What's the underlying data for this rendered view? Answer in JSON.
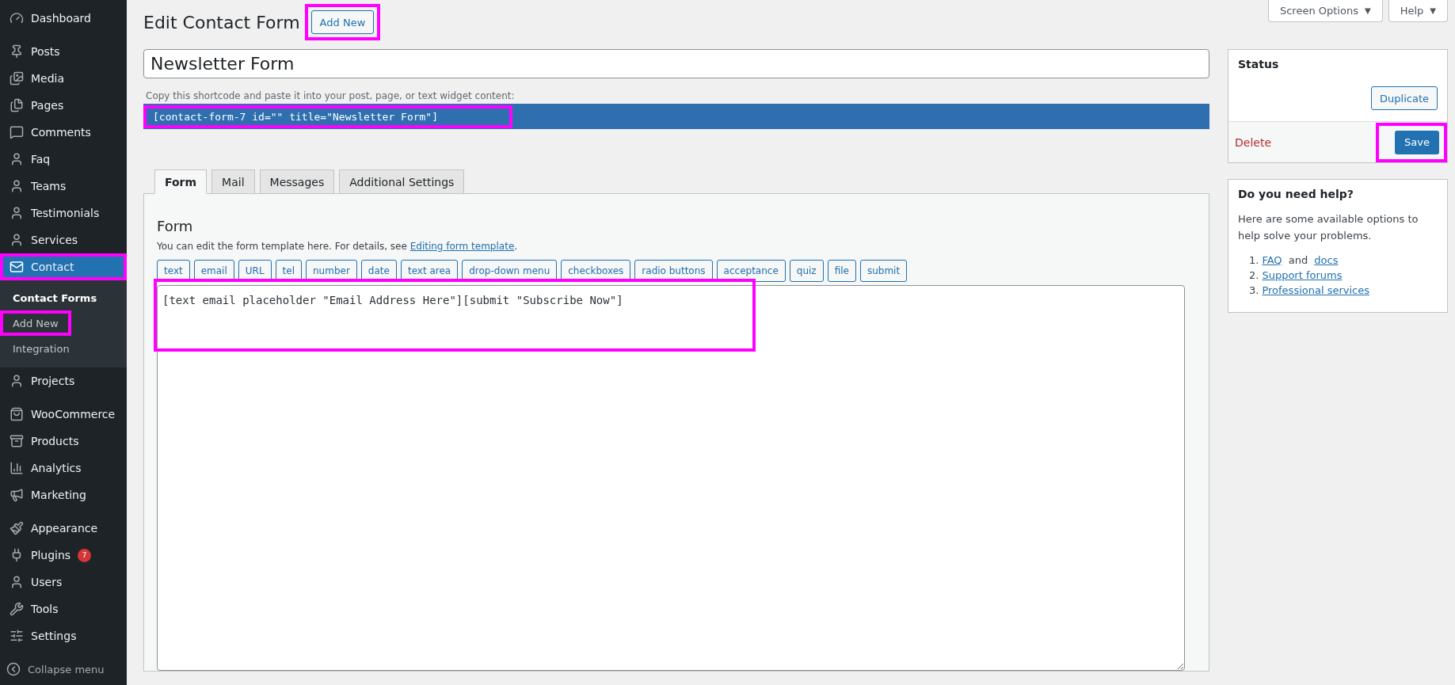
{
  "sidebar": {
    "groups": [
      {
        "items": [
          {
            "label": "Dashboard",
            "selected": false,
            "highlighted": false
          }
        ]
      },
      {
        "items": [
          {
            "label": "Posts",
            "selected": false,
            "highlighted": false
          },
          {
            "label": "Media",
            "selected": false,
            "highlighted": false
          },
          {
            "label": "Pages",
            "selected": false,
            "highlighted": false
          },
          {
            "label": "Comments",
            "selected": false,
            "highlighted": false
          },
          {
            "label": "Faq",
            "selected": false,
            "highlighted": false
          },
          {
            "label": "Teams",
            "selected": false,
            "highlighted": false
          },
          {
            "label": "Testimonials",
            "selected": false,
            "highlighted": false
          },
          {
            "label": "Services",
            "selected": false,
            "highlighted": false
          },
          {
            "label": "Contact",
            "selected": true,
            "highlighted": true,
            "children": [
              {
                "label": "Contact Forms",
                "selected": true,
                "highlighted": false
              },
              {
                "label": "Add New",
                "selected": false,
                "highlighted": true
              },
              {
                "label": "Integration",
                "selected": false,
                "highlighted": false
              }
            ]
          },
          {
            "label": "Projects",
            "selected": false,
            "highlighted": false
          }
        ]
      },
      {
        "items": [
          {
            "label": "WooCommerce",
            "selected": false,
            "highlighted": false
          },
          {
            "label": "Products",
            "selected": false,
            "highlighted": false
          },
          {
            "label": "Analytics",
            "selected": false,
            "highlighted": false
          },
          {
            "label": "Marketing",
            "selected": false,
            "highlighted": false
          }
        ]
      },
      {
        "items": [
          {
            "label": "Appearance",
            "selected": false,
            "highlighted": false
          },
          {
            "label": "Plugins",
            "selected": false,
            "highlighted": false,
            "badge": "7"
          },
          {
            "label": "Users",
            "selected": false,
            "highlighted": false
          },
          {
            "label": "Tools",
            "selected": false,
            "highlighted": false
          },
          {
            "label": "Settings",
            "selected": false,
            "highlighted": false
          }
        ]
      }
    ],
    "collapse": "Collapse menu"
  },
  "top_buttons": [
    {
      "label": "Screen Options",
      "caret": "▼"
    },
    {
      "label": "Help",
      "caret": "▼"
    }
  ],
  "page_title": "Edit Contact Form",
  "add_new": {
    "label": "Add New",
    "highlighted": true
  },
  "title_field": {
    "value": "Newsletter Form"
  },
  "shortcode_hint": "Copy this shortcode and paste it into your post, page, or text widget content:",
  "shortcode": {
    "text": "[contact-form-7 id=\"\" title=\"Newsletter Form\"]",
    "highlighted": true
  },
  "tabs": [
    {
      "label": "Form",
      "selected": true
    },
    {
      "label": "Mail",
      "selected": false
    },
    {
      "label": "Messages",
      "selected": false
    },
    {
      "label": "Additional Settings",
      "selected": false
    }
  ],
  "form_panel": {
    "heading": "Form",
    "description": "You can edit the form template here. For details, see ",
    "link": "Editing form template",
    "after_link": ".",
    "tag_buttons": [
      "text",
      "email",
      "URL",
      "tel",
      "number",
      "date",
      "text area",
      "drop-down menu",
      "checkboxes",
      "radio buttons",
      "acceptance",
      "quiz",
      "file",
      "submit"
    ],
    "template": {
      "value": "[text email placeholder \"Email Address Here\"][submit \"Subscribe Now\"]",
      "highlighted": true
    }
  },
  "status_box": {
    "title": "Status",
    "duplicate": "Duplicate",
    "delete": "Delete",
    "save": {
      "label": "Save",
      "highlighted": true
    }
  },
  "help_box": {
    "title": "Do you need help?",
    "text": "Here are some available options to help solve your problems.",
    "links": [
      {
        "number": "1.",
        "parts": [
          {
            "kind": "link",
            "text": "FAQ"
          },
          {
            "kind": "text",
            "text": " and "
          },
          {
            "kind": "link",
            "text": "docs"
          }
        ]
      },
      {
        "number": "2.",
        "parts": [
          {
            "kind": "link",
            "text": "Support forums"
          }
        ]
      },
      {
        "number": "3.",
        "parts": [
          {
            "kind": "link",
            "text": "Professional services"
          }
        ]
      }
    ]
  }
}
